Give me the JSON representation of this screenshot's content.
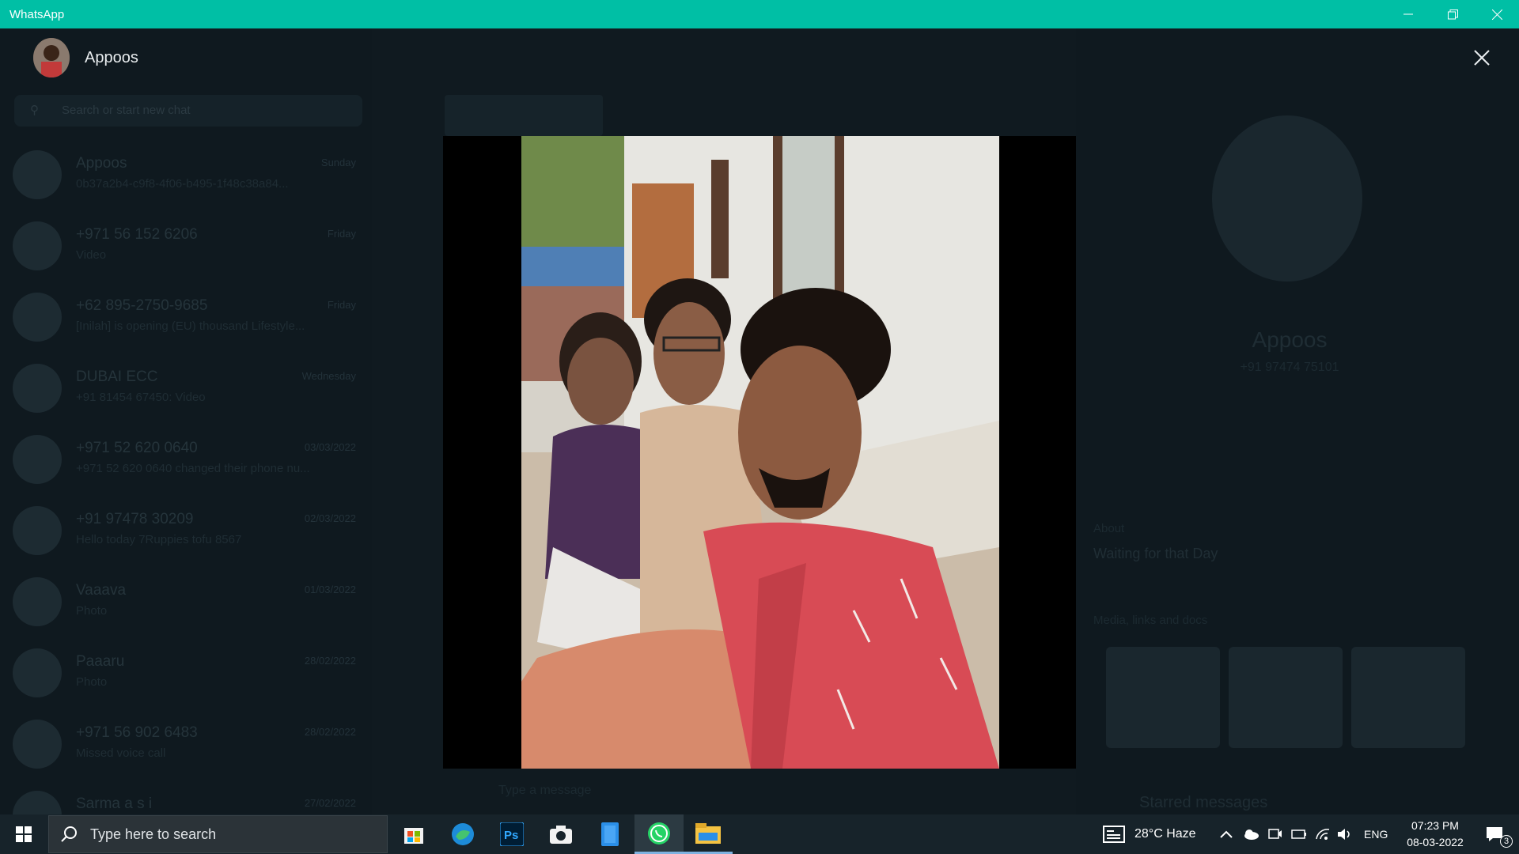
{
  "window": {
    "title": "WhatsApp"
  },
  "viewer": {
    "contact_name": "Appoos"
  },
  "sidebar": {
    "search_placeholder": "Search or start new chat",
    "chats": [
      {
        "name": "Appoos",
        "time": "Sunday",
        "preview": "0b37a2b4-c9f8-4f06-b495-1f48c38a84..."
      },
      {
        "name": "+971 56 152 6206",
        "time": "Friday",
        "preview": "Video"
      },
      {
        "name": "+62 895-2750-9685",
        "time": "Friday",
        "preview": "[Inilah] is opening (EU) thousand Lifestyle..."
      },
      {
        "name": "DUBAI ECC",
        "time": "Wednesday",
        "preview": "+91 81454 67450: Video"
      },
      {
        "name": "+971 52 620 0640",
        "time": "03/03/2022",
        "preview": "+971 52 620 0640 changed their phone nu..."
      },
      {
        "name": "+91 97478 30209",
        "time": "02/03/2022",
        "preview": "Hello today 7Ruppies tofu 8567"
      },
      {
        "name": "Vaaava",
        "time": "01/03/2022",
        "preview": "Photo"
      },
      {
        "name": "Paaaru",
        "time": "28/02/2022",
        "preview": "Photo"
      },
      {
        "name": "+971 56 902 6483",
        "time": "28/02/2022",
        "preview": "Missed voice call"
      },
      {
        "name": "Sarma a s i",
        "time": "27/02/2022",
        "preview": ""
      }
    ]
  },
  "compose": {
    "placeholder": "Type a message"
  },
  "info": {
    "name": "Appoos",
    "phone": "+91 97474 75101",
    "about_label": "About",
    "about_value": "Waiting for that Day",
    "media_label": "Media, links and docs",
    "starred": "Starred messages"
  },
  "taskbar": {
    "search_placeholder": "Type here to search",
    "weather": "28°C  Haze",
    "language": "ENG",
    "time": "07:23 PM",
    "date": "08-03-2022",
    "notifications": "3"
  },
  "colors": {
    "titlebar": "#00bfa5",
    "taskbar": "#17232a",
    "accent_active": "#00a884"
  }
}
